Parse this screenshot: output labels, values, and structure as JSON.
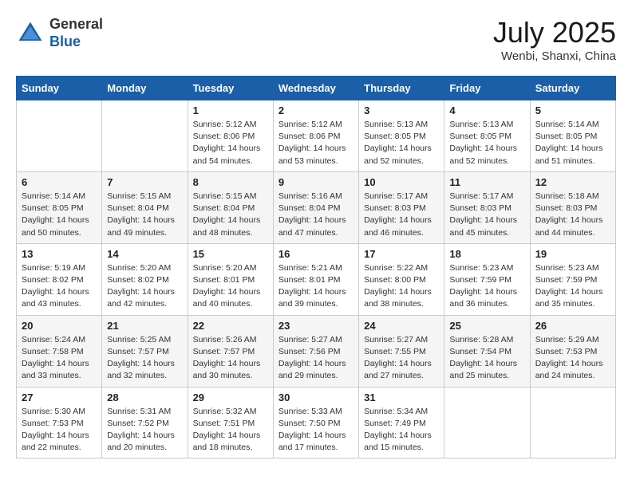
{
  "header": {
    "logo_general": "General",
    "logo_blue": "Blue",
    "month": "July 2025",
    "location": "Wenbi, Shanxi, China"
  },
  "weekdays": [
    "Sunday",
    "Monday",
    "Tuesday",
    "Wednesday",
    "Thursday",
    "Friday",
    "Saturday"
  ],
  "weeks": [
    [
      {
        "day": "",
        "sunrise": "",
        "sunset": "",
        "daylight": ""
      },
      {
        "day": "",
        "sunrise": "",
        "sunset": "",
        "daylight": ""
      },
      {
        "day": "1",
        "sunrise": "Sunrise: 5:12 AM",
        "sunset": "Sunset: 8:06 PM",
        "daylight": "Daylight: 14 hours and 54 minutes."
      },
      {
        "day": "2",
        "sunrise": "Sunrise: 5:12 AM",
        "sunset": "Sunset: 8:06 PM",
        "daylight": "Daylight: 14 hours and 53 minutes."
      },
      {
        "day": "3",
        "sunrise": "Sunrise: 5:13 AM",
        "sunset": "Sunset: 8:05 PM",
        "daylight": "Daylight: 14 hours and 52 minutes."
      },
      {
        "day": "4",
        "sunrise": "Sunrise: 5:13 AM",
        "sunset": "Sunset: 8:05 PM",
        "daylight": "Daylight: 14 hours and 52 minutes."
      },
      {
        "day": "5",
        "sunrise": "Sunrise: 5:14 AM",
        "sunset": "Sunset: 8:05 PM",
        "daylight": "Daylight: 14 hours and 51 minutes."
      }
    ],
    [
      {
        "day": "6",
        "sunrise": "Sunrise: 5:14 AM",
        "sunset": "Sunset: 8:05 PM",
        "daylight": "Daylight: 14 hours and 50 minutes."
      },
      {
        "day": "7",
        "sunrise": "Sunrise: 5:15 AM",
        "sunset": "Sunset: 8:04 PM",
        "daylight": "Daylight: 14 hours and 49 minutes."
      },
      {
        "day": "8",
        "sunrise": "Sunrise: 5:15 AM",
        "sunset": "Sunset: 8:04 PM",
        "daylight": "Daylight: 14 hours and 48 minutes."
      },
      {
        "day": "9",
        "sunrise": "Sunrise: 5:16 AM",
        "sunset": "Sunset: 8:04 PM",
        "daylight": "Daylight: 14 hours and 47 minutes."
      },
      {
        "day": "10",
        "sunrise": "Sunrise: 5:17 AM",
        "sunset": "Sunset: 8:03 PM",
        "daylight": "Daylight: 14 hours and 46 minutes."
      },
      {
        "day": "11",
        "sunrise": "Sunrise: 5:17 AM",
        "sunset": "Sunset: 8:03 PM",
        "daylight": "Daylight: 14 hours and 45 minutes."
      },
      {
        "day": "12",
        "sunrise": "Sunrise: 5:18 AM",
        "sunset": "Sunset: 8:03 PM",
        "daylight": "Daylight: 14 hours and 44 minutes."
      }
    ],
    [
      {
        "day": "13",
        "sunrise": "Sunrise: 5:19 AM",
        "sunset": "Sunset: 8:02 PM",
        "daylight": "Daylight: 14 hours and 43 minutes."
      },
      {
        "day": "14",
        "sunrise": "Sunrise: 5:20 AM",
        "sunset": "Sunset: 8:02 PM",
        "daylight": "Daylight: 14 hours and 42 minutes."
      },
      {
        "day": "15",
        "sunrise": "Sunrise: 5:20 AM",
        "sunset": "Sunset: 8:01 PM",
        "daylight": "Daylight: 14 hours and 40 minutes."
      },
      {
        "day": "16",
        "sunrise": "Sunrise: 5:21 AM",
        "sunset": "Sunset: 8:01 PM",
        "daylight": "Daylight: 14 hours and 39 minutes."
      },
      {
        "day": "17",
        "sunrise": "Sunrise: 5:22 AM",
        "sunset": "Sunset: 8:00 PM",
        "daylight": "Daylight: 14 hours and 38 minutes."
      },
      {
        "day": "18",
        "sunrise": "Sunrise: 5:23 AM",
        "sunset": "Sunset: 7:59 PM",
        "daylight": "Daylight: 14 hours and 36 minutes."
      },
      {
        "day": "19",
        "sunrise": "Sunrise: 5:23 AM",
        "sunset": "Sunset: 7:59 PM",
        "daylight": "Daylight: 14 hours and 35 minutes."
      }
    ],
    [
      {
        "day": "20",
        "sunrise": "Sunrise: 5:24 AM",
        "sunset": "Sunset: 7:58 PM",
        "daylight": "Daylight: 14 hours and 33 minutes."
      },
      {
        "day": "21",
        "sunrise": "Sunrise: 5:25 AM",
        "sunset": "Sunset: 7:57 PM",
        "daylight": "Daylight: 14 hours and 32 minutes."
      },
      {
        "day": "22",
        "sunrise": "Sunrise: 5:26 AM",
        "sunset": "Sunset: 7:57 PM",
        "daylight": "Daylight: 14 hours and 30 minutes."
      },
      {
        "day": "23",
        "sunrise": "Sunrise: 5:27 AM",
        "sunset": "Sunset: 7:56 PM",
        "daylight": "Daylight: 14 hours and 29 minutes."
      },
      {
        "day": "24",
        "sunrise": "Sunrise: 5:27 AM",
        "sunset": "Sunset: 7:55 PM",
        "daylight": "Daylight: 14 hours and 27 minutes."
      },
      {
        "day": "25",
        "sunrise": "Sunrise: 5:28 AM",
        "sunset": "Sunset: 7:54 PM",
        "daylight": "Daylight: 14 hours and 25 minutes."
      },
      {
        "day": "26",
        "sunrise": "Sunrise: 5:29 AM",
        "sunset": "Sunset: 7:53 PM",
        "daylight": "Daylight: 14 hours and 24 minutes."
      }
    ],
    [
      {
        "day": "27",
        "sunrise": "Sunrise: 5:30 AM",
        "sunset": "Sunset: 7:53 PM",
        "daylight": "Daylight: 14 hours and 22 minutes."
      },
      {
        "day": "28",
        "sunrise": "Sunrise: 5:31 AM",
        "sunset": "Sunset: 7:52 PM",
        "daylight": "Daylight: 14 hours and 20 minutes."
      },
      {
        "day": "29",
        "sunrise": "Sunrise: 5:32 AM",
        "sunset": "Sunset: 7:51 PM",
        "daylight": "Daylight: 14 hours and 18 minutes."
      },
      {
        "day": "30",
        "sunrise": "Sunrise: 5:33 AM",
        "sunset": "Sunset: 7:50 PM",
        "daylight": "Daylight: 14 hours and 17 minutes."
      },
      {
        "day": "31",
        "sunrise": "Sunrise: 5:34 AM",
        "sunset": "Sunset: 7:49 PM",
        "daylight": "Daylight: 14 hours and 15 minutes."
      },
      {
        "day": "",
        "sunrise": "",
        "sunset": "",
        "daylight": ""
      },
      {
        "day": "",
        "sunrise": "",
        "sunset": "",
        "daylight": ""
      }
    ]
  ]
}
